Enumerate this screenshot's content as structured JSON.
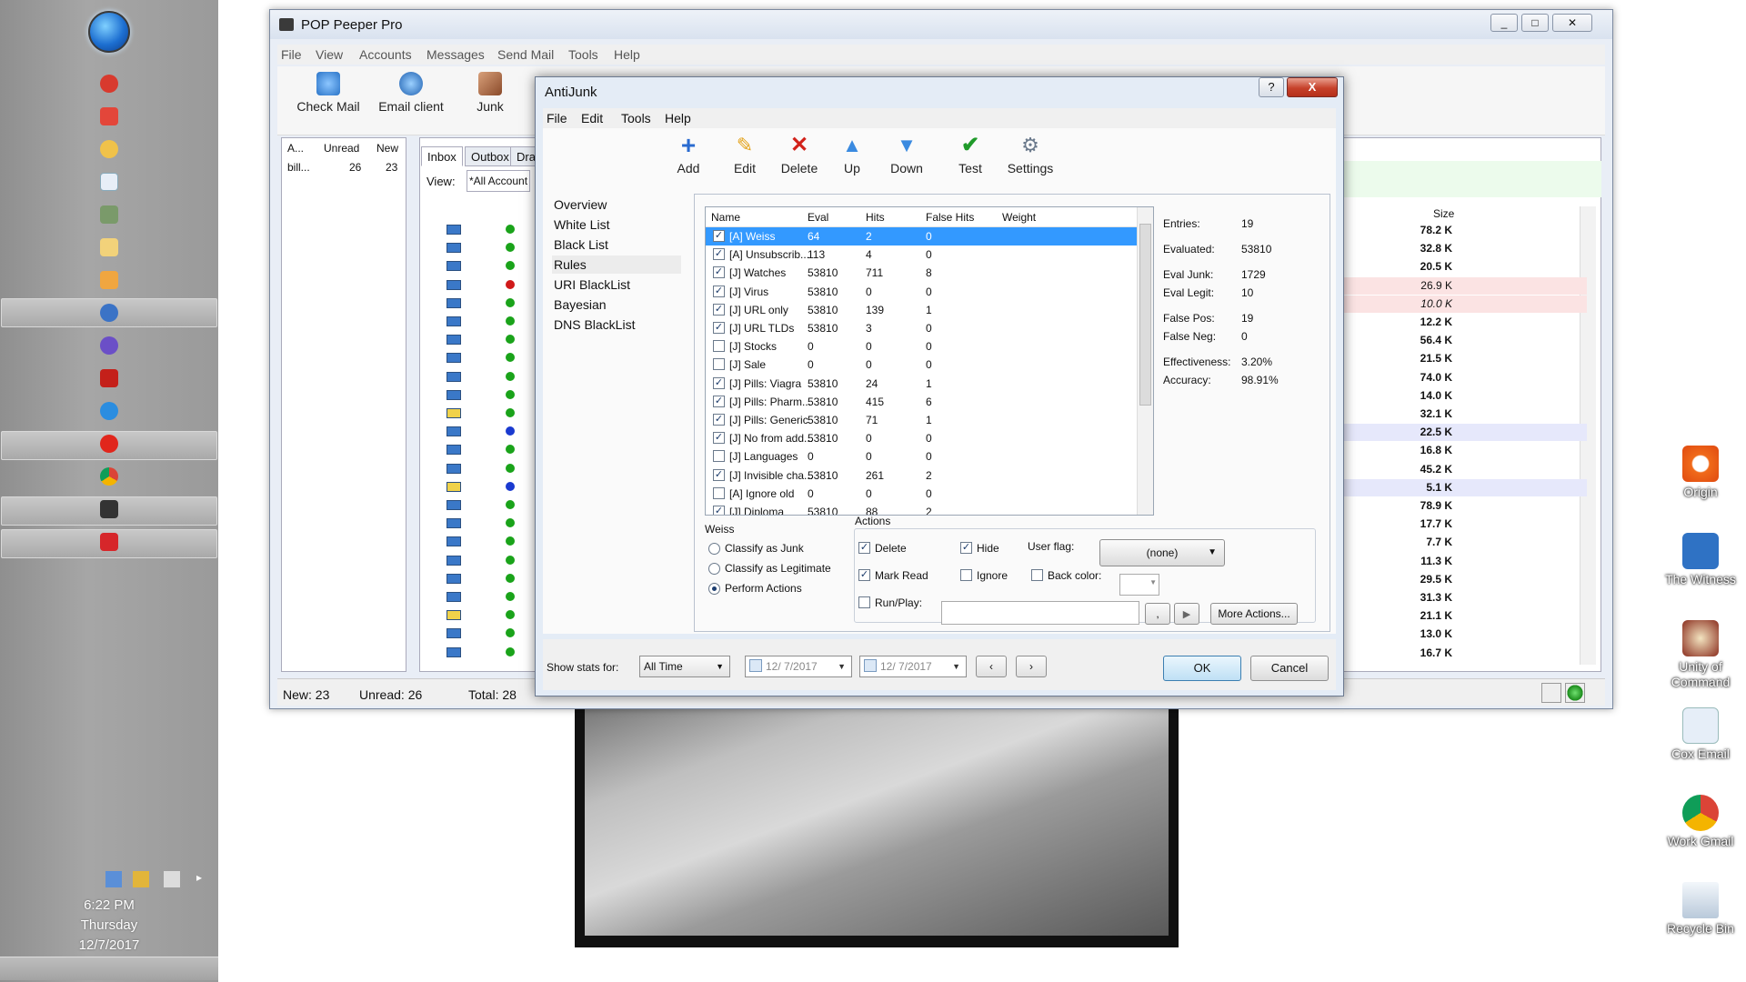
{
  "taskbar": {
    "time": "6:22 PM",
    "day": "Thursday",
    "date": "12/7/2017"
  },
  "desktop_icons": [
    "Origin",
    "The Witness",
    "Unity of Command",
    "Cox Email",
    "Work Gmail",
    "Recycle Bin"
  ],
  "main_window": {
    "title": "POP Peeper Pro",
    "menu": [
      "File",
      "View",
      "Accounts",
      "Messages",
      "Send Mail",
      "Tools",
      "Help"
    ],
    "toolbar": {
      "check_mail": "Check Mail",
      "email_client": "Email client",
      "junk": "Junk"
    },
    "accounts": {
      "headers": [
        "A...",
        "Unread",
        "New"
      ],
      "row": {
        "name": "bill...",
        "unread": "26",
        "new": "23"
      }
    },
    "tabs": [
      "Inbox",
      "Outbox",
      "Dra"
    ],
    "view_label": "View:",
    "view_value": "*All Account",
    "size_header": "Size",
    "sizes": [
      "78.2 K",
      "32.8 K",
      "20.5 K",
      "26.9 K",
      "10.0 K",
      "12.2 K",
      "56.4 K",
      "21.5 K",
      "74.0 K",
      "14.0 K",
      "32.1 K",
      "22.5 K",
      "16.8 K",
      "45.2 K",
      "5.1 K",
      "78.9 K",
      "17.7 K",
      "7.7 K",
      "11.3 K",
      "29.5 K",
      "31.3 K",
      "21.1 K",
      "13.0 K",
      "16.7 K"
    ],
    "status": {
      "new": "New: 23",
      "unread": "Unread: 26",
      "total": "Total: 28"
    }
  },
  "antijunk": {
    "title": "AntiJunk",
    "help_btn": "?",
    "close_btn": "X",
    "menu": [
      "File",
      "Edit",
      "Tools",
      "Help"
    ],
    "toolbar": [
      "Add",
      "Edit",
      "Delete",
      "Up",
      "Down",
      "Test",
      "Settings"
    ],
    "nav": [
      "Overview",
      "White List",
      "Black List",
      "Rules",
      "URI BlackList",
      "Bayesian",
      "DNS BlackList"
    ],
    "rules_headers": [
      "Name",
      "Eval",
      "Hits",
      "False Hits",
      "Weight"
    ],
    "rules": [
      {
        "checked": true,
        "name": "[A] Weiss",
        "eval": "64",
        "hits": "2",
        "false_hits": "0"
      },
      {
        "checked": true,
        "name": "[A] Unsubscrib...",
        "eval": "113",
        "hits": "4",
        "false_hits": "0"
      },
      {
        "checked": true,
        "name": "[J] Watches",
        "eval": "53810",
        "hits": "711",
        "false_hits": "8"
      },
      {
        "checked": true,
        "name": "[J] Virus",
        "eval": "53810",
        "hits": "0",
        "false_hits": "0"
      },
      {
        "checked": true,
        "name": "[J] URL only",
        "eval": "53810",
        "hits": "139",
        "false_hits": "1"
      },
      {
        "checked": true,
        "name": "[J] URL TLDs",
        "eval": "53810",
        "hits": "3",
        "false_hits": "0"
      },
      {
        "checked": false,
        "name": "[J] Stocks",
        "eval": "0",
        "hits": "0",
        "false_hits": "0"
      },
      {
        "checked": false,
        "name": "[J] Sale",
        "eval": "0",
        "hits": "0",
        "false_hits": "0"
      },
      {
        "checked": true,
        "name": "[J] Pills: Viagra",
        "eval": "53810",
        "hits": "24",
        "false_hits": "1"
      },
      {
        "checked": true,
        "name": "[J] Pills: Pharm...",
        "eval": "53810",
        "hits": "415",
        "false_hits": "6"
      },
      {
        "checked": true,
        "name": "[J] Pills: Generic",
        "eval": "53810",
        "hits": "71",
        "false_hits": "1"
      },
      {
        "checked": true,
        "name": "[J] No from add...",
        "eval": "53810",
        "hits": "0",
        "false_hits": "0"
      },
      {
        "checked": false,
        "name": "[J] Languages",
        "eval": "0",
        "hits": "0",
        "false_hits": "0"
      },
      {
        "checked": true,
        "name": "[J] Invisible cha...",
        "eval": "53810",
        "hits": "261",
        "false_hits": "2"
      },
      {
        "checked": false,
        "name": "[A] Ignore old",
        "eval": "0",
        "hits": "0",
        "false_hits": "0"
      },
      {
        "checked": true,
        "name": "[J] Diploma",
        "eval": "53810",
        "hits": "88",
        "false_hits": "2"
      }
    ],
    "stats": {
      "entries_label": "Entries:",
      "entries": "19",
      "evaluated_label": "Evaluated:",
      "evaluated": "53810",
      "eval_junk_label": "Eval Junk:",
      "eval_junk": "1729",
      "eval_legit_label": "Eval Legit:",
      "eval_legit": "10",
      "false_pos_label": "False Pos:",
      "false_pos": "19",
      "false_neg_label": "False Neg:",
      "false_neg": "0",
      "effectiveness_label": "Effectiveness:",
      "effectiveness": "3.20%",
      "accuracy_label": "Accuracy:",
      "accuracy": "98.91%"
    },
    "weiss_group": {
      "title": "Weiss",
      "options": [
        "Classify as Junk",
        "Classify as Legitimate",
        "Perform Actions"
      ]
    },
    "actions_group": {
      "title": "Actions",
      "delete": "Delete",
      "hide": "Hide",
      "mark_read": "Mark Read",
      "ignore": "Ignore",
      "user_flag_label": "User flag:",
      "user_flag_value": "(none)",
      "back_color_label": "Back color:",
      "run_play_label": "Run/Play:",
      "more_actions": "More Actions..."
    },
    "footer": {
      "show_stats_label": "Show stats for:",
      "show_stats_value": "All Time",
      "date_from": "12/  7/2017",
      "date_to": "12/  7/2017",
      "ok": "OK",
      "cancel": "Cancel"
    }
  }
}
